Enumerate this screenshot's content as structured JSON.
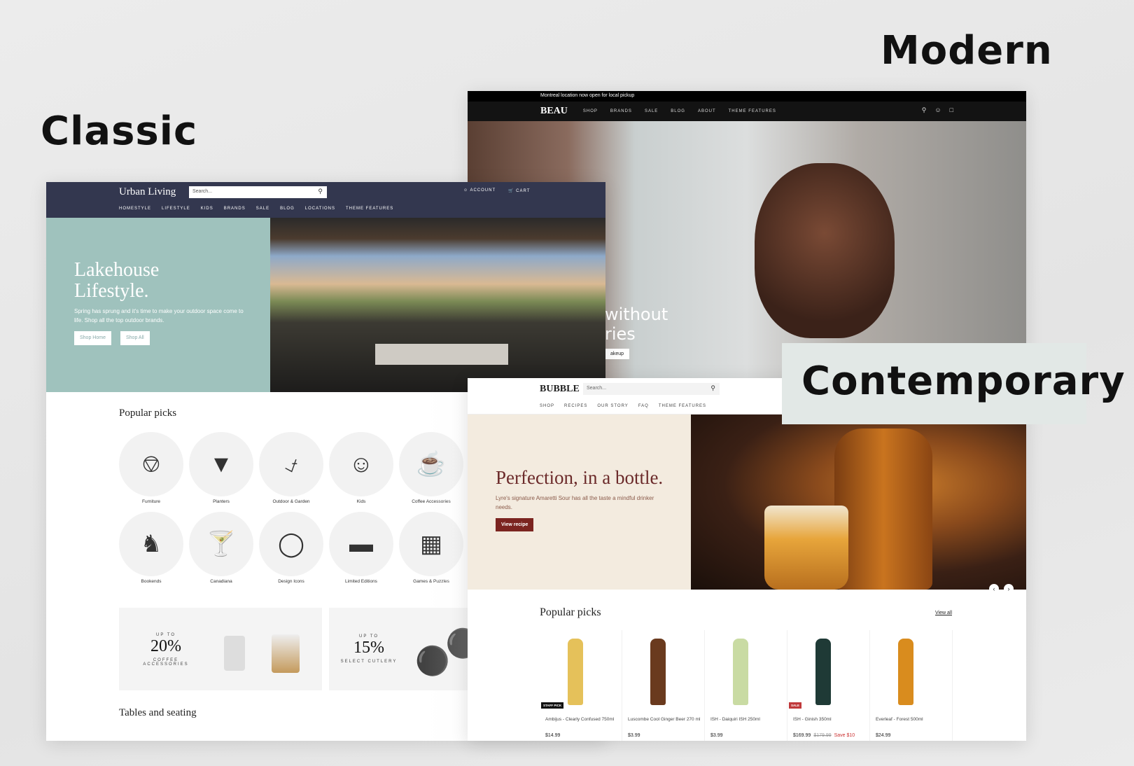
{
  "labels": {
    "modern": "Modern",
    "classic": "Classic",
    "contemporary": "Contemporary"
  },
  "modern": {
    "announcement": "Montreal location now open for local pickup",
    "logo": "BEAU",
    "nav": [
      "SHOP",
      "BRANDS",
      "SALE",
      "BLOG",
      "ABOUT",
      "THEME FEATURES"
    ],
    "icons": [
      "search-icon",
      "account-icon",
      "bag-icon"
    ],
    "hero_text": "without\nries",
    "hero_button": "akeup"
  },
  "classic": {
    "logo": "Urban Living",
    "search_placeholder": "Search...",
    "account": "ACCOUNT",
    "cart": "CART",
    "nav": [
      "HOMESTYLE",
      "LIFESTYLE",
      "KIDS",
      "BRANDS",
      "SALE",
      "BLOG",
      "LOCATIONS",
      "THEME FEATURES"
    ],
    "hero": {
      "title": "Lakehouse Lifestyle.",
      "subtitle": "Spring has sprung and it's time to make your outdoor space come to life. Shop all the top outdoor brands.",
      "buttons": [
        "Shop Home",
        "Shop All"
      ]
    },
    "popular_title": "Popular picks",
    "categories": [
      "Furniture",
      "Planters",
      "Outdoor & Garden",
      "Kids",
      "Coffee Accessories",
      "Bookends",
      "Canadiana",
      "Design Icons",
      "Limited Editions",
      "Games & Puzzles"
    ],
    "promos": [
      {
        "up_to": "UP TO",
        "pct": "20%",
        "sub": "COFFEE ACCESSORIES"
      },
      {
        "up_to": "UP TO",
        "pct": "15%",
        "sub": "SELECT CUTLERY"
      }
    ],
    "tables_title": "Tables and seating"
  },
  "contemporary": {
    "logo": "BUBBLE",
    "search_placeholder": "Search...",
    "nav": [
      "SHOP",
      "RECIPES",
      "OUR STORY",
      "FAQ",
      "THEME FEATURES"
    ],
    "hero": {
      "title": "Perfection, in a bottle.",
      "subtitle": "Lyre's signature Amaretti Sour has all the taste a mindful drinker needs.",
      "button": "View recipe"
    },
    "popular_title": "Popular picks",
    "view_all": "View all",
    "products": [
      {
        "name": "Ambijus - Clearly Confused 750ml",
        "price": "$14.99",
        "badge": "STAFF PICK",
        "color": "#e5c15a"
      },
      {
        "name": "Luscombe Cool Ginger Beer 270 ml",
        "price": "$3.99",
        "badge": "",
        "color": "#6a3a1e"
      },
      {
        "name": "ISH - Daiquiri ISH 250ml",
        "price": "$3.99",
        "badge": "",
        "color": "#c9dba3"
      },
      {
        "name": "ISH - Ginish 350ml",
        "price": "$169.99",
        "was": "$179.99",
        "save": "Save $10",
        "badge": "SALE",
        "color": "#1f3a36"
      },
      {
        "name": "Everleaf - Forest 500ml",
        "price": "$24.99",
        "badge": "",
        "color": "#d98c1e"
      }
    ],
    "badge_colors": {
      "STAFF PICK": "#111111",
      "SALE": "#c0393b"
    }
  }
}
